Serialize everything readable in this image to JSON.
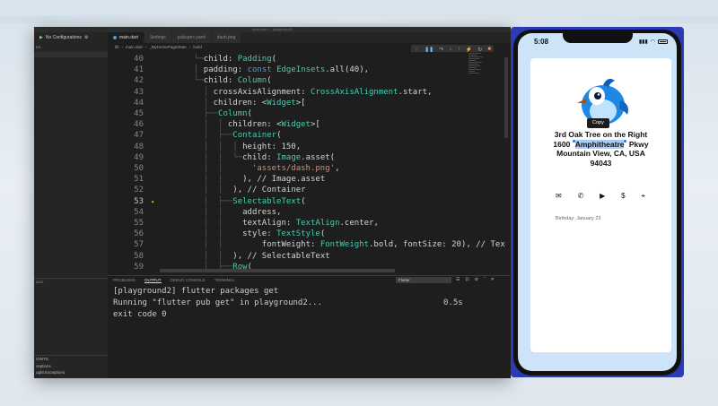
{
  "window": {
    "title": "main.dart — playground2"
  },
  "sidebar": {
    "config_label": "No Configurations",
    "section_label": "ES",
    "stack_label": "ACK",
    "breakpoints_label": "OINTS",
    "items": [
      "ceptions",
      "ught Exceptions"
    ]
  },
  "tabs": [
    {
      "label": "main.dart",
      "active": true
    },
    {
      "label": "Settings",
      "active": false
    },
    {
      "label": "pubspec.yaml",
      "active": false
    },
    {
      "label": "dash.png",
      "active": false
    }
  ],
  "breadcrumb": [
    "lib",
    "main.dart",
    "_MyHomePageState",
    "build"
  ],
  "editor": {
    "current_line": 53,
    "lines": [
      {
        "n": "40",
        "guides": "       └─",
        "parts": [
          [
            "cm",
            "child: "
          ],
          [
            "ty",
            "Padding"
          ],
          [
            "cm",
            "("
          ]
        ]
      },
      {
        "n": "41",
        "guides": "       │ ",
        "parts": [
          [
            "cm",
            "padding: "
          ],
          [
            "kw",
            "const "
          ],
          [
            "ty",
            "EdgeInsets"
          ],
          [
            "cm",
            ".all(40),"
          ]
        ]
      },
      {
        "n": "42",
        "guides": "       └─",
        "parts": [
          [
            "cm",
            "child: "
          ],
          [
            "ty",
            "Column"
          ],
          [
            "cm",
            "("
          ]
        ]
      },
      {
        "n": "43",
        "guides": "         │ ",
        "parts": [
          [
            "cm",
            "crossAxisAlignment: "
          ],
          [
            "ty",
            "CrossAxisAlignment"
          ],
          [
            "cm",
            ".start,"
          ]
        ]
      },
      {
        "n": "44",
        "guides": "         │ ",
        "parts": [
          [
            "cm",
            "children: <"
          ],
          [
            "ty",
            "Widget"
          ],
          [
            "cm",
            ">["
          ]
        ]
      },
      {
        "n": "45",
        "guides": "         ├──",
        "parts": [
          [
            "ty",
            "Column"
          ],
          [
            "cm",
            "("
          ]
        ]
      },
      {
        "n": "46",
        "guides": "         │  │ ",
        "parts": [
          [
            "cm",
            "children: <"
          ],
          [
            "ty",
            "Widget"
          ],
          [
            "cm",
            ">["
          ]
        ]
      },
      {
        "n": "47",
        "guides": "         │  ├──",
        "parts": [
          [
            "ty",
            "Container"
          ],
          [
            "cm",
            "("
          ]
        ]
      },
      {
        "n": "48",
        "guides": "         │  │  │ ",
        "parts": [
          [
            "cm",
            "height: 150,"
          ]
        ]
      },
      {
        "n": "49",
        "guides": "         │  │  └─",
        "parts": [
          [
            "cm",
            "child: "
          ],
          [
            "ty",
            "Image"
          ],
          [
            "cm",
            ".asset("
          ]
        ]
      },
      {
        "n": "50",
        "guides": "         │  │      ",
        "parts": [
          [
            "st",
            "'assets/dash.png'"
          ],
          [
            "cm",
            ","
          ]
        ]
      },
      {
        "n": "51",
        "guides": "         │  │    ",
        "parts": [
          [
            "cm",
            "), "
          ],
          [
            "cm",
            "// Image.asset"
          ]
        ]
      },
      {
        "n": "52",
        "guides": "         │  │  ",
        "parts": [
          [
            "cm",
            "), "
          ],
          [
            "cm",
            "// Container"
          ]
        ]
      },
      {
        "n": "53",
        "guides": "         │  ├──",
        "parts": [
          [
            "ty",
            "SelectableText"
          ],
          [
            "cm",
            "("
          ]
        ]
      },
      {
        "n": "54",
        "guides": "         │  │    ",
        "parts": [
          [
            "cm",
            "address,"
          ]
        ]
      },
      {
        "n": "55",
        "guides": "         │  │    ",
        "parts": [
          [
            "cm",
            "textAlign: "
          ],
          [
            "ty",
            "TextAlign"
          ],
          [
            "cm",
            ".center,"
          ]
        ]
      },
      {
        "n": "56",
        "guides": "         │  │    ",
        "parts": [
          [
            "cm",
            "style: "
          ],
          [
            "ty",
            "TextStyle"
          ],
          [
            "cm",
            "("
          ]
        ]
      },
      {
        "n": "57",
        "guides": "         │  │        ",
        "parts": [
          [
            "cm",
            "fontWeight: "
          ],
          [
            "ty",
            "FontWeight"
          ],
          [
            "cm",
            ".bold, fontSize: 20), // Tex"
          ]
        ]
      },
      {
        "n": "58",
        "guides": "         │  │  ",
        "parts": [
          [
            "cm",
            "), "
          ],
          [
            "cm",
            "// SelectableText"
          ]
        ]
      },
      {
        "n": "59",
        "guides": "         │  ├──",
        "parts": [
          [
            "ty",
            "Row"
          ],
          [
            "cm",
            "("
          ]
        ]
      }
    ]
  },
  "panel": {
    "tabs": [
      "PROBLEMS",
      "OUTPUT",
      "DEBUG CONSOLE",
      "TERMINAL"
    ],
    "active_tab": "OUTPUT",
    "channel": "Flutter",
    "output": [
      {
        "text": "[playground2] flutter packages get",
        "time": ""
      },
      {
        "text": "Running \"flutter pub get\" in playground2...",
        "time": "0.5s"
      },
      {
        "text": "exit code 0",
        "time": ""
      }
    ]
  },
  "phone": {
    "time": "5:08",
    "copy_label": "Copy",
    "address_lines": [
      {
        "pre": "3rd Oak Tree on the Right",
        "hl": "",
        "post": ""
      },
      {
        "pre": "1600 ",
        "hl": "Amphitheatre",
        "post": " Pkwy"
      },
      {
        "pre": "Mountain View, CA, USA",
        "hl": "",
        "post": ""
      },
      {
        "pre": "94043",
        "hl": "",
        "post": ""
      }
    ],
    "actions": [
      {
        "name": "email-icon",
        "glyph": "✉"
      },
      {
        "name": "phone-icon",
        "glyph": "✆"
      },
      {
        "name": "video-icon",
        "glyph": "▶"
      },
      {
        "name": "money-icon",
        "glyph": "$"
      },
      {
        "name": "location-icon",
        "glyph": "⌖"
      }
    ],
    "birthday": "Birthday: January 23"
  },
  "colors": {
    "accent": "#2a3bb5",
    "selection": "#a9cdf5",
    "screen_bg": "#cde3f8"
  }
}
